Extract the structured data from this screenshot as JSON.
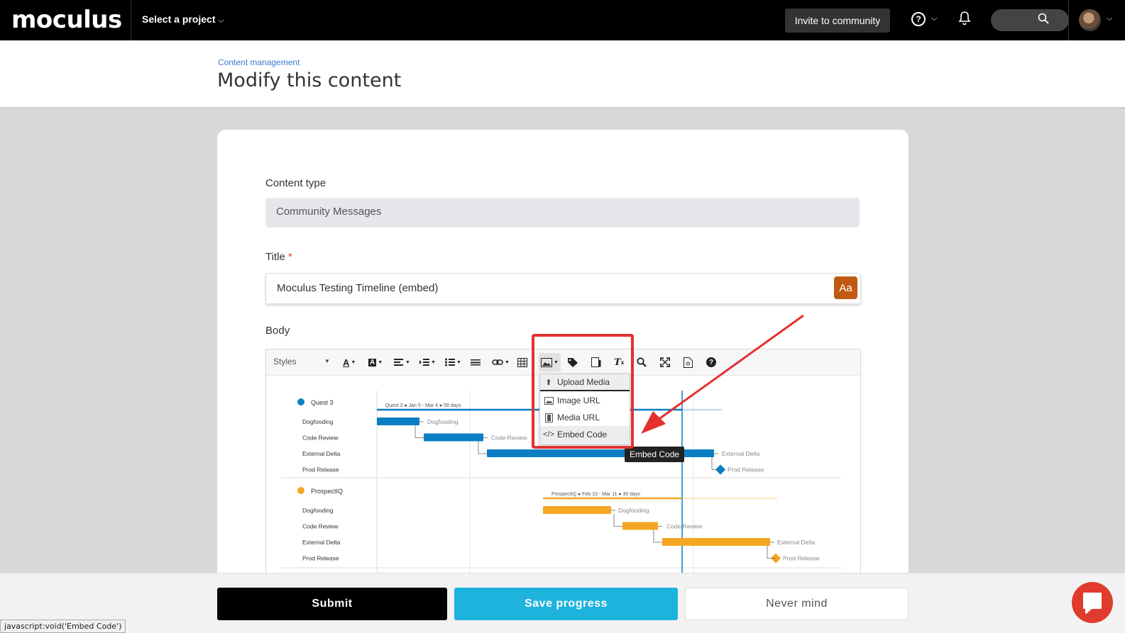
{
  "topnav": {
    "logo": "moculus",
    "project_selector": "Select a project",
    "invite_button": "Invite to community",
    "help_icon": "?"
  },
  "header": {
    "breadcrumb": "Content management",
    "title": "Modify this content"
  },
  "form": {
    "content_type_label": "Content type",
    "content_type_value": "Community Messages",
    "title_label": "Title",
    "title_required": "*",
    "title_value": "Moculus Testing Timeline (embed)",
    "title_button": "Aa",
    "body_label": "Body"
  },
  "toolbar": {
    "styles": "Styles"
  },
  "media_menu": {
    "items": [
      "Upload Media",
      "Image URL",
      "Media URL",
      "Embed Code"
    ],
    "tooltip": "Embed Code"
  },
  "gantt": {
    "groups": [
      {
        "name": "Quest 3",
        "color": "#0a7fc2",
        "summary": {
          "name": "Quest 3",
          "dates": "Jan 5 - Mar 4",
          "duration": "59 days"
        },
        "tasks": [
          "Dogfooding",
          "Code Review",
          "External Delta",
          "Prod Release"
        ],
        "bar_labels": [
          "Dogfooding",
          "Code Review",
          "External Delta",
          "Prod Release"
        ]
      },
      {
        "name": "ProspectIQ",
        "color": "#f5a623",
        "summary": {
          "name": "ProspectIQ",
          "dates": "Feb 10 - Mar 11",
          "duration": "30 days"
        },
        "tasks": [
          "Dogfooding",
          "Code Review",
          "External Delta",
          "Prod Release"
        ],
        "bar_labels": [
          "Dogfooding",
          "Code Review",
          "External Delta",
          "Prod Release"
        ]
      }
    ]
  },
  "footer": {
    "submit": "Submit",
    "save": "Save progress",
    "never": "Never mind"
  },
  "status_bar": "javascript:void('Embed Code')"
}
